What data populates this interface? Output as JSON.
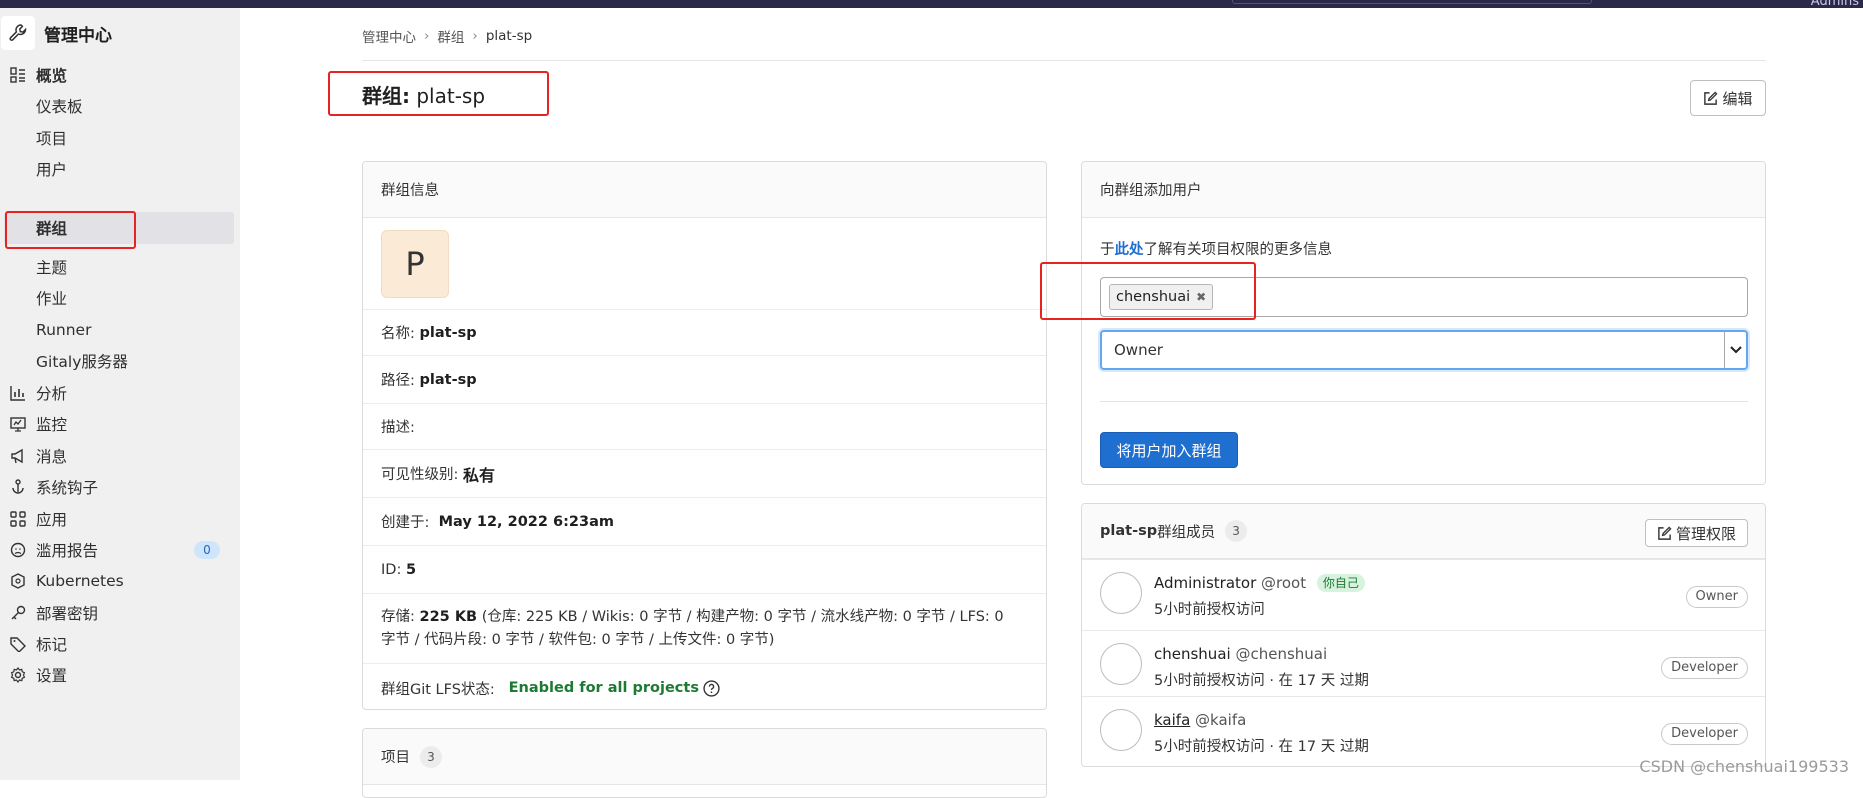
{
  "topbar": {
    "admin_label": "Admins"
  },
  "sidebar": {
    "title": "管理中心",
    "overview": "概览",
    "sub_items": [
      "仪表板",
      "项目",
      "用户",
      "群组",
      "主题",
      "作业",
      "Runner",
      "Gitaly服务器"
    ],
    "items": [
      {
        "label": "分析",
        "icon": "analytics-icon"
      },
      {
        "label": "监控",
        "icon": "monitor-icon"
      },
      {
        "label": "消息",
        "icon": "megaphone-icon"
      },
      {
        "label": "系统钩子",
        "icon": "hook-icon"
      },
      {
        "label": "应用",
        "icon": "apps-icon"
      },
      {
        "label": "滥用报告",
        "icon": "abuse-icon",
        "badge": "0"
      },
      {
        "label": "Kubernetes",
        "icon": "kubernetes-icon"
      },
      {
        "label": "部署密钥",
        "icon": "key-icon"
      },
      {
        "label": "标记",
        "icon": "label-icon"
      },
      {
        "label": "设置",
        "icon": "settings-icon"
      }
    ]
  },
  "breadcrumb": [
    "管理中心",
    "群组",
    "plat-sp"
  ],
  "page": {
    "title_prefix": "群组:",
    "title_name": "plat-sp",
    "edit_label": "编辑"
  },
  "group_info": {
    "header": "群组信息",
    "avatar_letter": "P",
    "name_label": "名称:",
    "name_value": "plat-sp",
    "path_label": "路径:",
    "path_value": "plat-sp",
    "desc_label": "描述:",
    "visibility_label": "可见性级别:",
    "visibility_value": "私有",
    "created_label": "创建于:",
    "created_value": "May 12, 2022 6:23am",
    "id_label": "ID:",
    "id_value": "5",
    "storage_label": "存储:",
    "storage_value": "225 KB",
    "storage_detail_1": "(仓库: 225 KB / Wikis: 0 字节 / 构建产物: 0 字节 / 流水线产物: 0 字节 / LFS: 0",
    "storage_detail_2": "字节 / 代码片段: 0 字节 / 软件包: 0 字节 / 上传文件: 0 字节)",
    "lfs_label": "群组Git LFS状态:",
    "lfs_value": "Enabled for all projects"
  },
  "projects_card": {
    "header": "项目",
    "count": "3"
  },
  "add_user": {
    "header": "向群组添加用户",
    "info_prefix": "于",
    "info_link": "此处",
    "info_suffix": "了解有关项目权限的更多信息",
    "token": "chenshuai",
    "role_value": "Owner",
    "submit_label": "将用户加入群组"
  },
  "members": {
    "group_name": "plat-sp",
    "header_suffix": "群组成员",
    "count": "3",
    "manage_label": "管理权限",
    "list": [
      {
        "name": "Administrator",
        "handle": "@root",
        "you": "你自己",
        "sub": "5小时前授权访问",
        "role": "Owner"
      },
      {
        "name": "chenshuai",
        "handle": "@chenshuai",
        "sub": "5小时前授权访问 · 在 17 天 过期",
        "role": "Developer"
      },
      {
        "name": "kaifa",
        "handle": "@kaifa",
        "sub": "5小时前授权访问 · 在 17 天 过期",
        "role": "Developer"
      }
    ]
  },
  "watermark": "CSDN @chenshuai199533"
}
